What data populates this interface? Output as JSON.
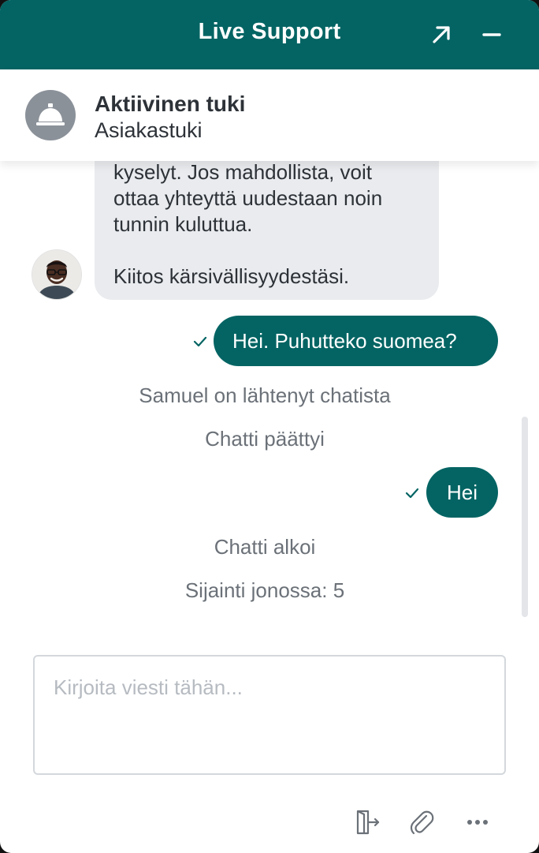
{
  "window": {
    "title": "Live Support",
    "expand_icon": "expand-arrow-icon",
    "minimize_icon": "minimize-icon",
    "header_color": "#036463"
  },
  "agent": {
    "icon": "service-bell-icon",
    "name": "Aktiivinen tuki",
    "department": "Asiakastuki"
  },
  "messages": {
    "incoming": {
      "lines": [
        "kyselyt. Jos mahdollista, voit",
        "ottaa yhteyttä uudestaan noin",
        "tunnin kuluttua.",
        "",
        "Kiitos kärsivällisyydestäsi."
      ],
      "sender_avatar": "operator-avatar"
    },
    "outgoing_1": "Hei. Puhutteko suomea?",
    "system_1": "Samuel on lähtenyt chatista",
    "system_2": "Chatti päättyi",
    "outgoing_2": "Hei",
    "system_3": "Chatti alkoi",
    "system_4": "Sijainti jonossa: 5",
    "delivered_icon": "checkmark-icon"
  },
  "composer": {
    "placeholder": "Kirjoita viesti tähän...",
    "value": ""
  },
  "footer": {
    "icons": [
      "exit-chat-icon",
      "paperclip-icon",
      "more-options-icon"
    ]
  }
}
